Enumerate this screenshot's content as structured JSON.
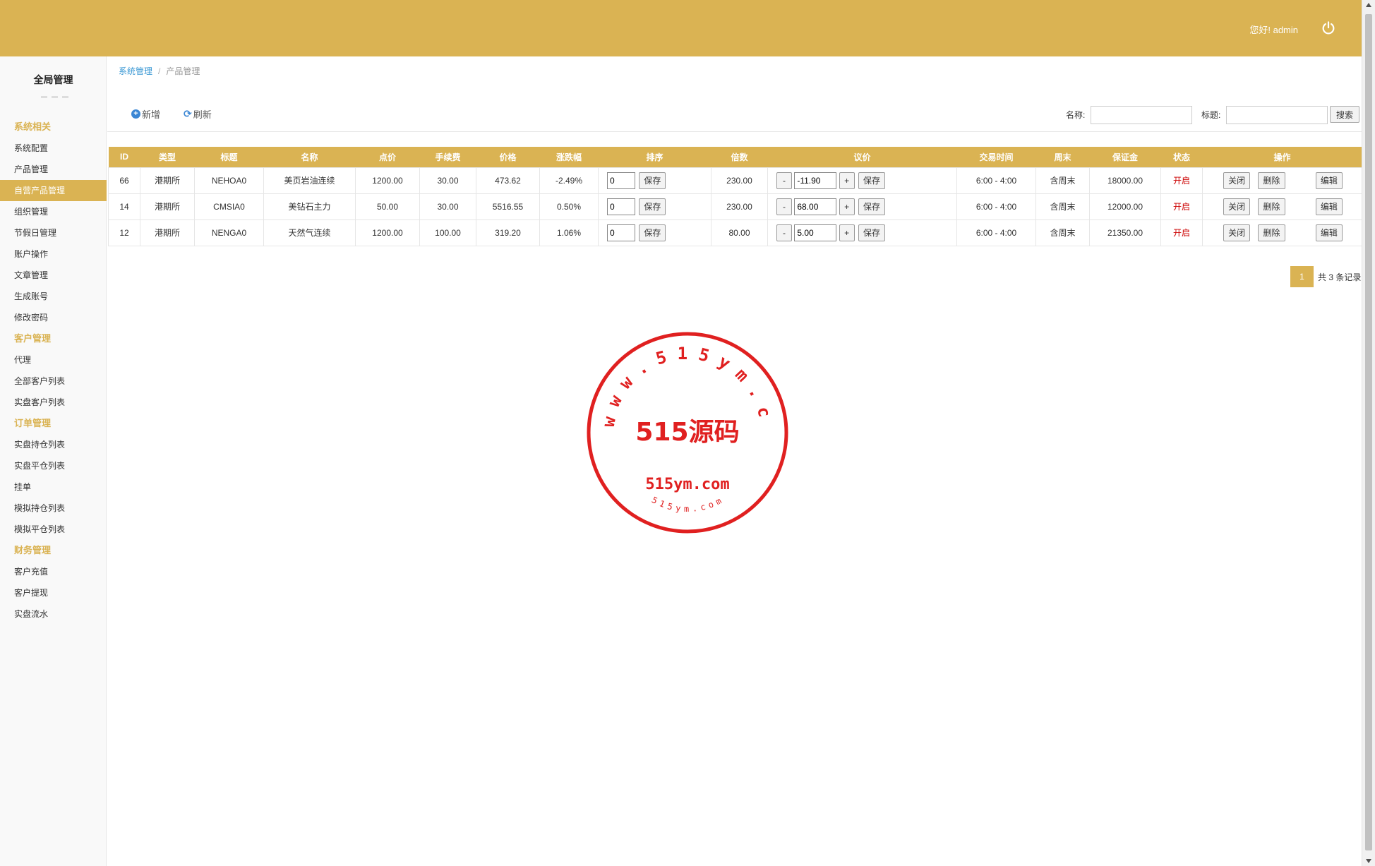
{
  "header": {
    "greeting": "您好! admin",
    "brand_color": "#dab353"
  },
  "sidebar": {
    "title": "全局管理",
    "items": [
      {
        "label": "系统相关",
        "type": "group"
      },
      {
        "label": "系统配置",
        "type": "item"
      },
      {
        "label": "产品管理",
        "type": "item"
      },
      {
        "label": "自营产品管理",
        "type": "item",
        "active": true
      },
      {
        "label": "组织管理",
        "type": "item"
      },
      {
        "label": "节假日管理",
        "type": "item"
      },
      {
        "label": "账户操作",
        "type": "item"
      },
      {
        "label": "文章管理",
        "type": "item"
      },
      {
        "label": "生成账号",
        "type": "item"
      },
      {
        "label": "修改密码",
        "type": "item"
      },
      {
        "label": "客户管理",
        "type": "group"
      },
      {
        "label": "代理",
        "type": "item"
      },
      {
        "label": "全部客户列表",
        "type": "item"
      },
      {
        "label": "实盘客户列表",
        "type": "item"
      },
      {
        "label": "订单管理",
        "type": "group"
      },
      {
        "label": "实盘持仓列表",
        "type": "item"
      },
      {
        "label": "实盘平仓列表",
        "type": "item"
      },
      {
        "label": "挂单",
        "type": "item"
      },
      {
        "label": "模拟持仓列表",
        "type": "item"
      },
      {
        "label": "模拟平仓列表",
        "type": "item"
      },
      {
        "label": "财务管理",
        "type": "group"
      },
      {
        "label": "客户充值",
        "type": "item"
      },
      {
        "label": "客户提现",
        "type": "item"
      },
      {
        "label": "实盘流水",
        "type": "item"
      }
    ]
  },
  "breadcrumb": {
    "parent": "系统管理",
    "separator": "/",
    "current": "产品管理"
  },
  "toolbar": {
    "add_label": "新增",
    "refresh_label": "刷新",
    "name_label": "名称:",
    "name_value": "",
    "title_label": "标题:",
    "title_value": "",
    "search_label": "搜索"
  },
  "table": {
    "headers": [
      "ID",
      "类型",
      "标题",
      "名称",
      "点价",
      "手续费",
      "价格",
      "涨跌幅",
      "排序",
      "倍数",
      "议价",
      "交易时间",
      "周末",
      "保证金",
      "状态",
      "操作"
    ],
    "rows": [
      {
        "id": "66",
        "type": "港期所",
        "title": "NEHOA0",
        "name": "美页岩油连续",
        "point": "1200.00",
        "fee": "30.00",
        "price": "473.62",
        "change": "-2.49%",
        "sort": "0",
        "multiple": "230.00",
        "bargain": "-11.90",
        "hours": "6:00 - 4:00",
        "weekend": "含周末",
        "margin": "18000.00",
        "status": "开启"
      },
      {
        "id": "14",
        "type": "港期所",
        "title": "CMSIA0",
        "name": "美钻石主力",
        "point": "50.00",
        "fee": "30.00",
        "price": "5516.55",
        "change": "0.50%",
        "sort": "0",
        "multiple": "230.00",
        "bargain": "68.00",
        "hours": "6:00 - 4:00",
        "weekend": "含周末",
        "margin": "12000.00",
        "status": "开启"
      },
      {
        "id": "12",
        "type": "港期所",
        "title": "NENGA0",
        "name": "天然气连续",
        "point": "1200.00",
        "fee": "100.00",
        "price": "319.20",
        "change": "1.06%",
        "sort": "0",
        "multiple": "80.00",
        "bargain": "5.00",
        "hours": "6:00 - 4:00",
        "weekend": "含周末",
        "margin": "21350.00",
        "status": "开启"
      }
    ],
    "actions": {
      "save": "保存",
      "minus": "-",
      "plus": "+",
      "close": "关闭",
      "delete": "删除",
      "edit": "编辑"
    }
  },
  "pagination": {
    "current_page": "1",
    "total_text": "共 3 条记录"
  },
  "watermark": {
    "ring_text": "www.515ym.com",
    "main_text": "515源码",
    "domain_text": "515ym.com",
    "bottom_text": "515ym.com",
    "color": "#e02020"
  }
}
